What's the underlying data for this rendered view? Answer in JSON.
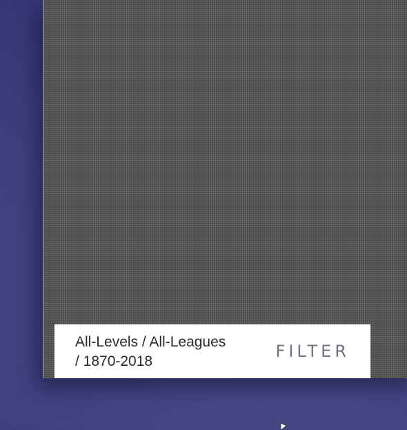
{
  "filter_bar": {
    "summary_line1": "All-Levels / All-Leagues",
    "summary_line2": "/ 1870-2018",
    "filter_label": "FILTER"
  },
  "cursor": {
    "icon": "pointer-cursor-icon"
  },
  "colors": {
    "desktop_background": "#4a4a8a",
    "window_background": "#4b4b4b",
    "filter_bar_background": "#ffffff",
    "filter_label_color": "#6f7480"
  }
}
